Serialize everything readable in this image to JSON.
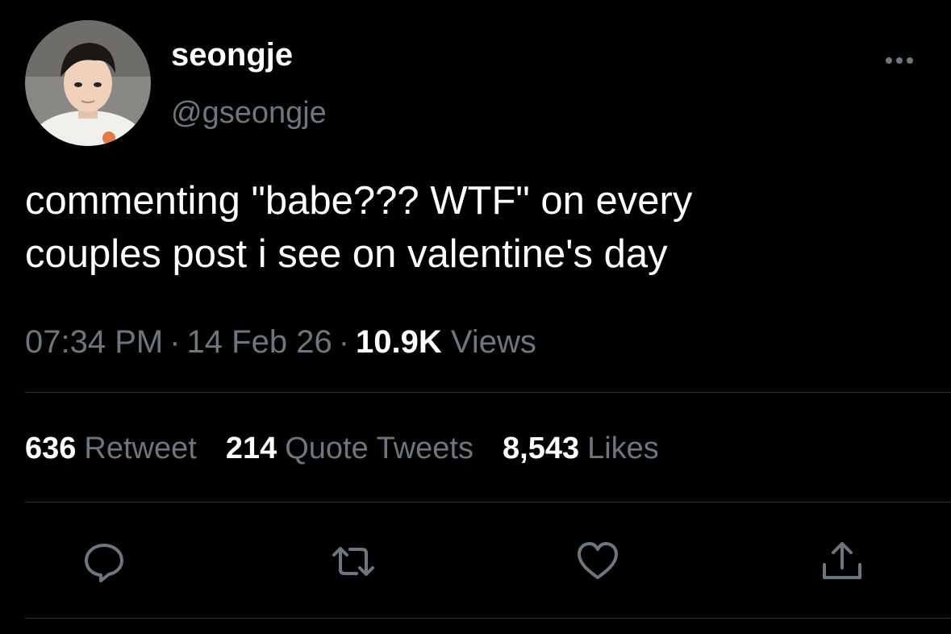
{
  "author": {
    "display_name": "seongje",
    "handle": "@gseongje"
  },
  "tweet": {
    "lines": [
      "commenting \"babe??? WTF\" on every",
      "couples post i see on valentine's day"
    ]
  },
  "meta": {
    "time": "07:34 PM",
    "separator": "·",
    "date": "14 Feb 26",
    "views_count": "10.9K",
    "views_label": "Views"
  },
  "stats": {
    "retweets": {
      "count": "636",
      "label": "Retweet"
    },
    "quotes": {
      "count": "214",
      "label": "Quote Tweets"
    },
    "likes": {
      "count": "8,543",
      "label": "Likes"
    }
  },
  "actions": {
    "reply_icon": "reply-icon",
    "retweet_icon": "retweet-icon",
    "like_icon": "heart-icon",
    "share_icon": "share-icon"
  },
  "colors": {
    "background": "#000000",
    "text_primary": "#ffffff",
    "text_secondary": "#6e767d",
    "divider": "#2f3336"
  }
}
